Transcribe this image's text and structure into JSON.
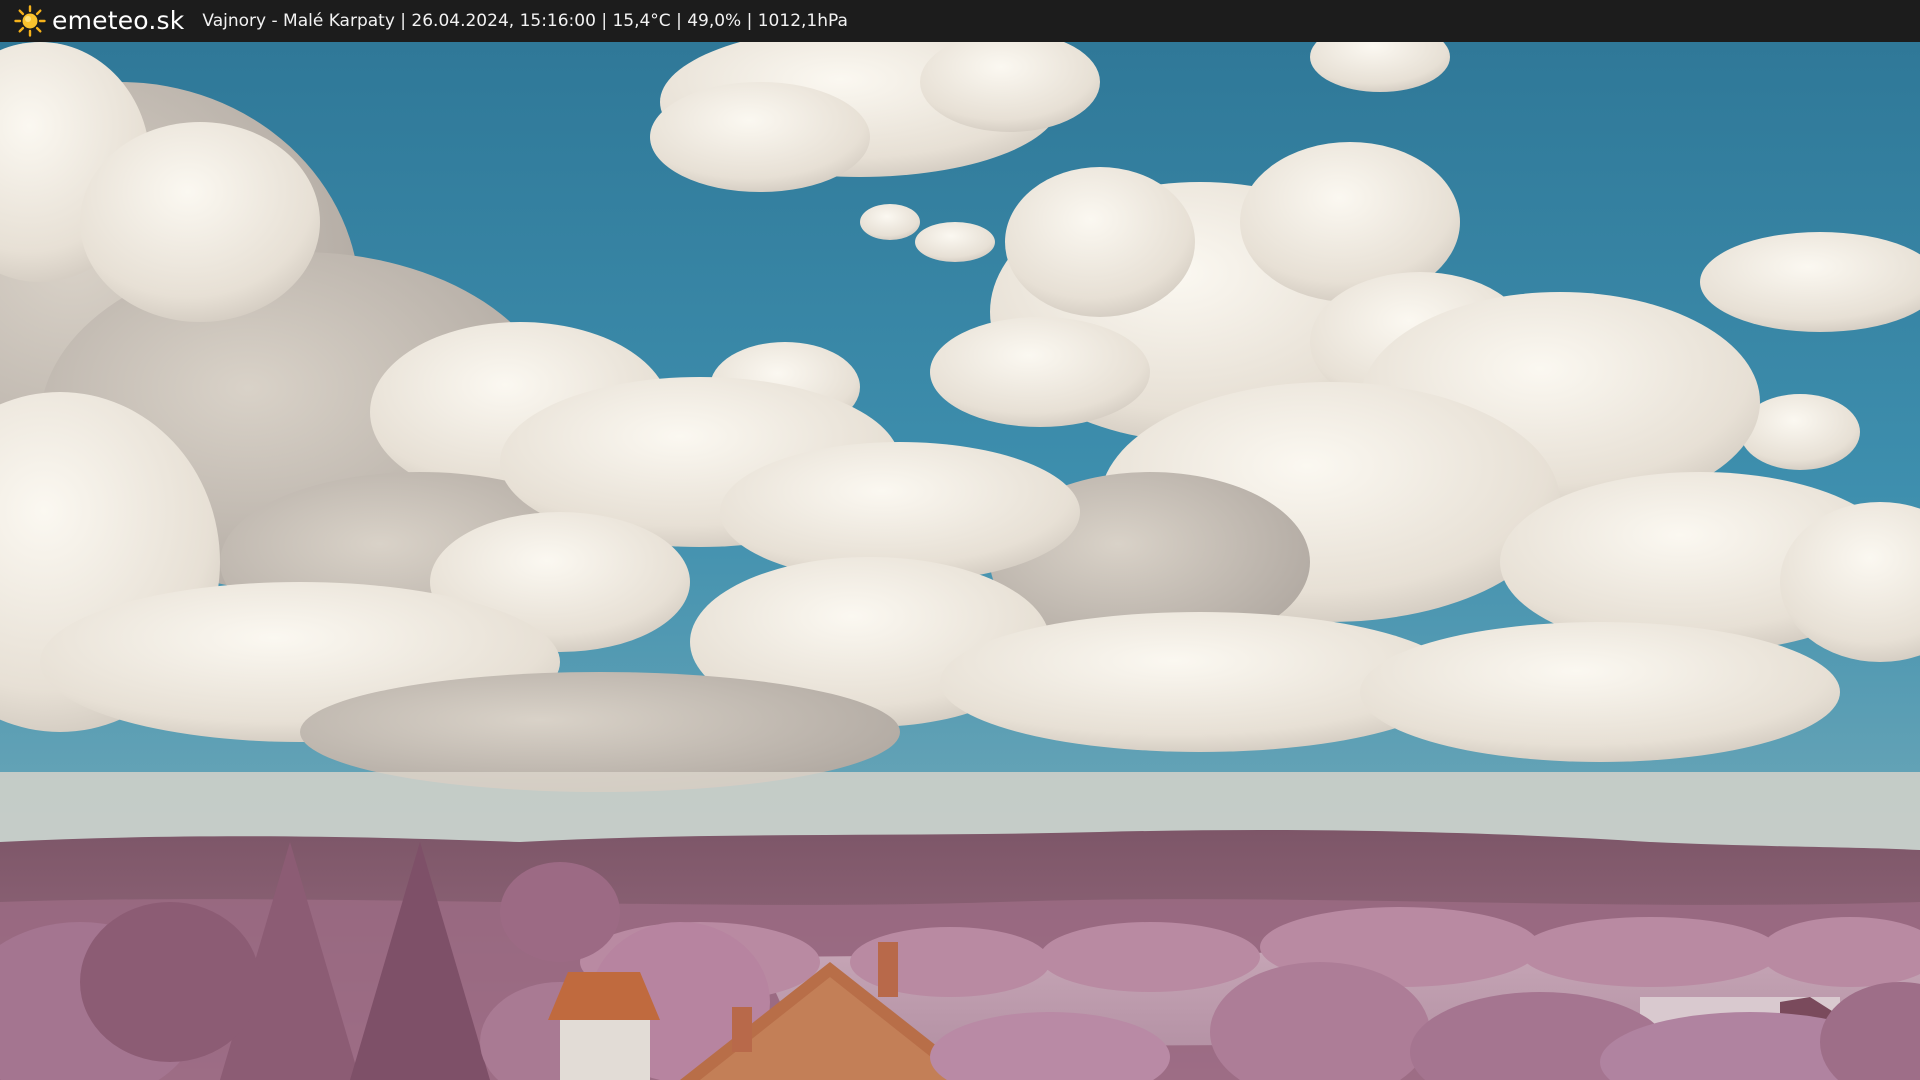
{
  "header": {
    "brand": "emeteo.sk",
    "logo_icon": "sun-icon",
    "caption": "Vajnory - Malé Karpaty | 26.04.2024, 15:16:00 | 15,4°C | 49,0% | 1012,1hPa"
  },
  "colors": {
    "bar": "#1c1c1c",
    "sky": "#3a86a8",
    "cloud": "#efe9df",
    "hills": "#8a5e72",
    "foliage": "#b07d98",
    "roof": "#b5643c"
  }
}
